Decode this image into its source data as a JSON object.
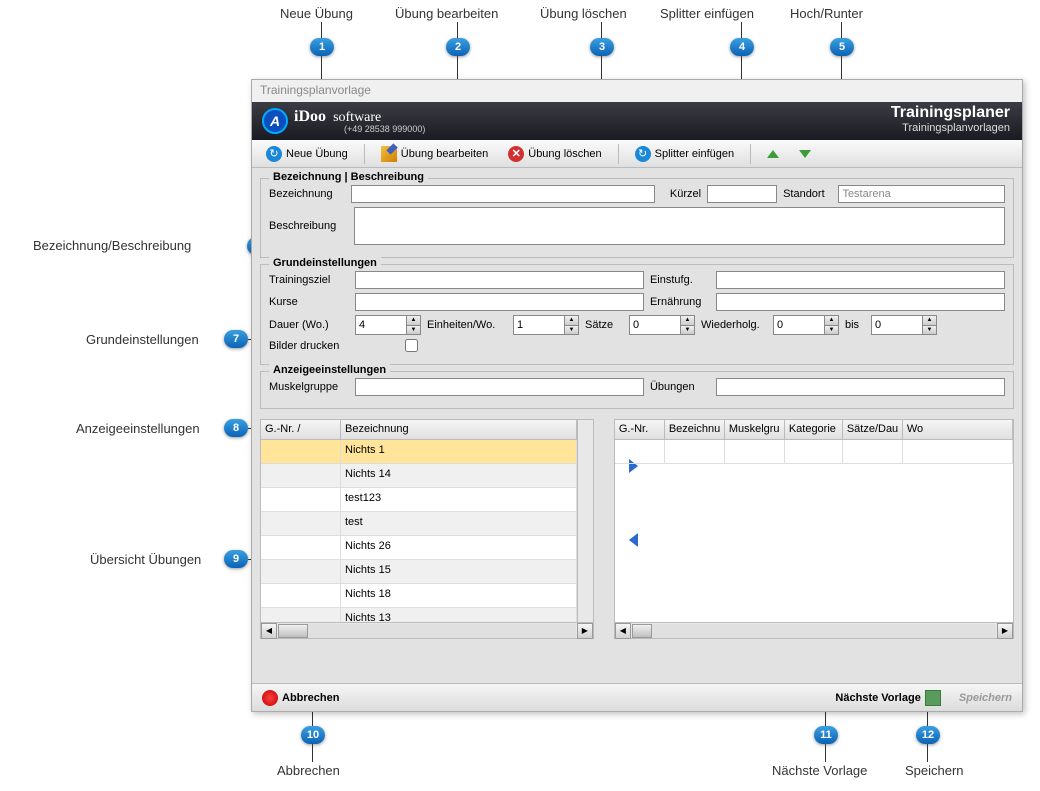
{
  "callouts": {
    "c1": "Neue Übung",
    "c2": "Übung bearbeiten",
    "c3": "Übung löschen",
    "c4": "Splitter einfügen",
    "c5": "Hoch/Runter",
    "c6": "Bezeichnung/Beschreibung",
    "c7": "Grundeinstellungen",
    "c8": "Anzeigeeinstellungen",
    "c9": "Übersicht Übungen",
    "c10": "Abbrechen",
    "c11": "Nächste Vorlage",
    "c12": "Speichern"
  },
  "window": {
    "title": "Trainingsplanvorlage",
    "brand": "iDoo",
    "brand_sub": "software",
    "brand_phone": "(+49 28538 999000)",
    "header_title": "Trainingsplaner",
    "header_subtitle": "Trainingsplanvorlagen"
  },
  "toolbar": {
    "new": "Neue Übung",
    "edit": "Übung bearbeiten",
    "delete": "Übung löschen",
    "splitter": "Splitter einfügen"
  },
  "group1": {
    "title": "Bezeichnung | Beschreibung",
    "bezeichnung_lbl": "Bezeichnung",
    "kuerzel_lbl": "Kürzel",
    "standort_lbl": "Standort",
    "standort_val": "Testarena",
    "beschreibung_lbl": "Beschreibung"
  },
  "group2": {
    "title": "Grundeinstellungen",
    "ziel_lbl": "Trainingsziel",
    "einstufg_lbl": "Einstufg.",
    "kurse_lbl": "Kurse",
    "ernaehrung_lbl": "Ernährung",
    "dauer_lbl": "Dauer (Wo.)",
    "dauer_val": "4",
    "einheiten_lbl": "Einheiten/Wo.",
    "einheiten_val": "1",
    "saetze_lbl": "Sätze",
    "saetze_val": "0",
    "wdh_lbl": "Wiederholg.",
    "wdh_val": "0",
    "bis_lbl": "bis",
    "bis_val": "0",
    "bilder_lbl": "Bilder drucken"
  },
  "group3": {
    "title": "Anzeigeeinstellungen",
    "muskel_lbl": "Muskelgruppe",
    "uebungen_lbl": "Übungen"
  },
  "left_table": {
    "cols": [
      "G.-Nr. /",
      "Bezeichnung"
    ],
    "rows": [
      "Nichts 1",
      "Nichts 14",
      "test123",
      "test",
      "Nichts 26",
      "Nichts 15",
      "Nichts 18",
      "Nichts 13"
    ]
  },
  "right_table": {
    "cols": [
      "G.-Nr.",
      "Bezeichnu",
      "Muskelgru",
      "Kategorie",
      "Sätze/Dau",
      "Wo"
    ]
  },
  "footer": {
    "cancel": "Abbrechen",
    "next": "Nächste Vorlage",
    "save": "Speichern"
  }
}
